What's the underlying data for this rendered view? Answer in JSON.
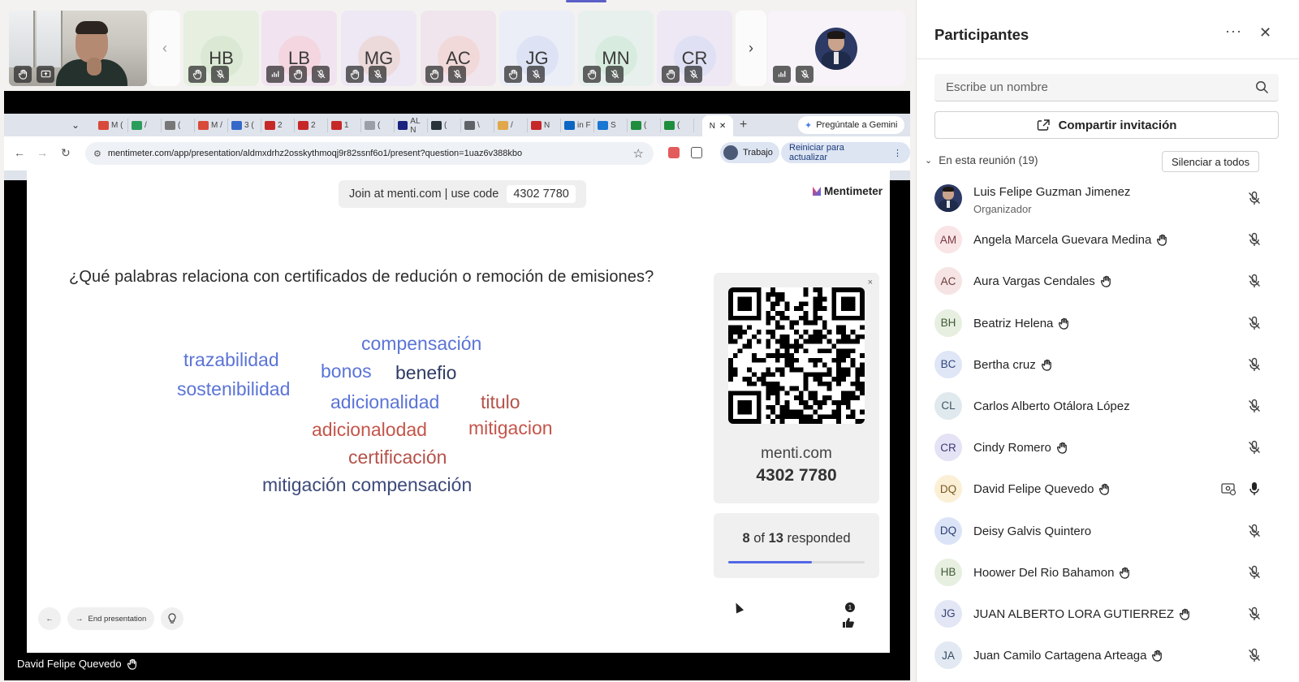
{
  "meeting": {
    "self_tile": {
      "has_video": true
    }
  },
  "gallery": {
    "tiles": [
      {
        "initials": "HB",
        "bg": "#e6efe0",
        "av": "#dbe9d4"
      },
      {
        "initials": "LB",
        "bg": "#f1e3ef",
        "av": "#f3d6e0"
      },
      {
        "initials": "MG",
        "bg": "#eee8f4",
        "av": "#ecd9d9"
      },
      {
        "initials": "AC",
        "bg": "#f0e5ec",
        "av": "#f2d9d9"
      },
      {
        "initials": "JG",
        "bg": "#eceef7",
        "av": "#dde3f5"
      },
      {
        "initials": "MN",
        "bg": "#e7f0ec",
        "av": "#d7ecdf"
      },
      {
        "initials": "CR",
        "bg": "#ede8f4",
        "av": "#dfe0f4"
      }
    ]
  },
  "browser": {
    "url": "mentimeter.com/app/presentation/aldmxdrhz2osskythmoqj9r82ssnf6o1/present?question=1uaz6v388kbo",
    "gemini_label": "Pregúntale a Gemini",
    "profile_label": "Trabajo",
    "update_label": "Reiniciar para actualizar",
    "tab_icons": [
      {
        "text": "M (",
        "color": "#d9493a"
      },
      {
        "text": "/",
        "color": "#2a9d5c"
      },
      {
        "text": "(",
        "color": "#777777"
      },
      {
        "text": "M /",
        "color": "#d9493a"
      },
      {
        "text": "3 (",
        "color": "#3569c9"
      },
      {
        "text": "2",
        "color": "#c62828"
      },
      {
        "text": "2",
        "color": "#c62828"
      },
      {
        "text": "1",
        "color": "#c62828"
      },
      {
        "text": "(",
        "color": "#9aa0a6"
      },
      {
        "text": "AL N",
        "color": "#1a237e"
      },
      {
        "text": "(",
        "color": "#263238"
      },
      {
        "text": "\\",
        "color": "#5f6368"
      },
      {
        "text": "/",
        "color": "#e0a84a"
      },
      {
        "text": "N",
        "color": "#c62828"
      },
      {
        "text": "in F",
        "color": "#0a66c2"
      },
      {
        "text": "S",
        "color": "#1976d2"
      },
      {
        "text": "(",
        "color": "#1e8e3e"
      },
      {
        "text": "(",
        "color": "#1e8e3e"
      }
    ],
    "active_tab_letter": "N"
  },
  "slide": {
    "join_text": "Join at menti.com | use code",
    "join_code": "4302 7780",
    "brand": "Mentimeter",
    "question": "¿Qué palabras relaciona con certificados de redución o remoción de emisiones?",
    "words": [
      {
        "text": "compensación",
        "color": "#5b74d6",
        "size": 23
      },
      {
        "text": "trazabilidad",
        "color": "#5b74d6",
        "size": 23
      },
      {
        "text": "bonos",
        "color": "#5b74d6",
        "size": 23
      },
      {
        "text": "benefio",
        "color": "#2f3b63",
        "size": 23
      },
      {
        "text": "sostenibilidad",
        "color": "#5b74d6",
        "size": 23
      },
      {
        "text": "adicionalidad",
        "color": "#5b74d6",
        "size": 23
      },
      {
        "text": "titulo",
        "color": "#b5524a",
        "size": 23
      },
      {
        "text": "adicionalodad",
        "color": "#c4554a",
        "size": 23
      },
      {
        "text": "mitigacion",
        "color": "#c4554a",
        "size": 23
      },
      {
        "text": "certificación",
        "color": "#b5524a",
        "size": 23
      },
      {
        "text": "mitigación compensación",
        "color": "#3d4a7a",
        "size": 23
      }
    ],
    "qr": {
      "url": "menti.com",
      "code": "4302 7780",
      "close": "×"
    },
    "responses": {
      "count": "8",
      "of_label": "of",
      "total": "13",
      "suffix": "responded",
      "fraction": 0.615
    },
    "end_label": "End presentation",
    "reactions": "1",
    "accent": "#5268e6"
  },
  "presenter": {
    "name": "David Felipe Quevedo"
  },
  "panel": {
    "title": "Participantes",
    "search_placeholder": "Escribe un nombre",
    "share_label": "Compartir invitación",
    "section_label": "En esta reunión (19)",
    "mute_all_label": "Silenciar a todos",
    "participants": [
      {
        "initials": "",
        "name": "Luis Felipe Guzman Jimenez",
        "role": "Organizador",
        "photo": true,
        "hand": false,
        "mic": "muted",
        "av": "#2d3a66",
        "fg": "#424242"
      },
      {
        "initials": "AM",
        "name": "Angela Marcela Guevara Medina",
        "role": "",
        "photo": false,
        "hand": true,
        "mic": "muted",
        "av": "#f9e4e6",
        "fg": "#7a3a42"
      },
      {
        "initials": "AC",
        "name": "Aura Vargas Cendales",
        "role": "",
        "photo": false,
        "hand": true,
        "mic": "muted",
        "av": "#f6e4e4",
        "fg": "#6b3b3b"
      },
      {
        "initials": "BH",
        "name": "Beatriz Helena",
        "role": "",
        "photo": false,
        "hand": true,
        "mic": "muted",
        "av": "#e7efe1",
        "fg": "#3f5a34"
      },
      {
        "initials": "BC",
        "name": "Bertha cruz",
        "role": "",
        "photo": false,
        "hand": true,
        "mic": "muted",
        "av": "#dfe6f6",
        "fg": "#34467a"
      },
      {
        "initials": "CL",
        "name": "Carlos Alberto Otálora López",
        "role": "",
        "photo": false,
        "hand": false,
        "mic": "muted",
        "av": "#e0e9ee",
        "fg": "#3c5563"
      },
      {
        "initials": "CR",
        "name": "Cindy Romero",
        "role": "",
        "photo": false,
        "hand": true,
        "mic": "muted",
        "av": "#e4e3f5",
        "fg": "#3d3b72"
      },
      {
        "initials": "DQ",
        "name": "David Felipe Quevedo",
        "role": "",
        "photo": false,
        "hand": true,
        "mic": "on",
        "sharing": true,
        "av": "#fbefd6",
        "fg": "#7a5a1f"
      },
      {
        "initials": "DQ",
        "name": "Deisy Galvis Quintero",
        "role": "",
        "photo": false,
        "hand": false,
        "mic": "muted",
        "av": "#dbe4f7",
        "fg": "#2c3e70"
      },
      {
        "initials": "HB",
        "name": "Hoower Del Rio Bahamon",
        "role": "",
        "photo": false,
        "hand": true,
        "mic": "muted",
        "av": "#e7efe1",
        "fg": "#3f5a34"
      },
      {
        "initials": "JG",
        "name": "JUAN ALBERTO LORA GUTIERREZ",
        "role": "",
        "photo": false,
        "hand": true,
        "mic": "muted",
        "av": "#e2e6f5",
        "fg": "#3a4472"
      },
      {
        "initials": "JA",
        "name": "Juan Camilo Cartagena Arteaga",
        "role": "",
        "photo": false,
        "hand": true,
        "mic": "muted",
        "av": "#e2e9f2",
        "fg": "#344a63"
      }
    ]
  }
}
